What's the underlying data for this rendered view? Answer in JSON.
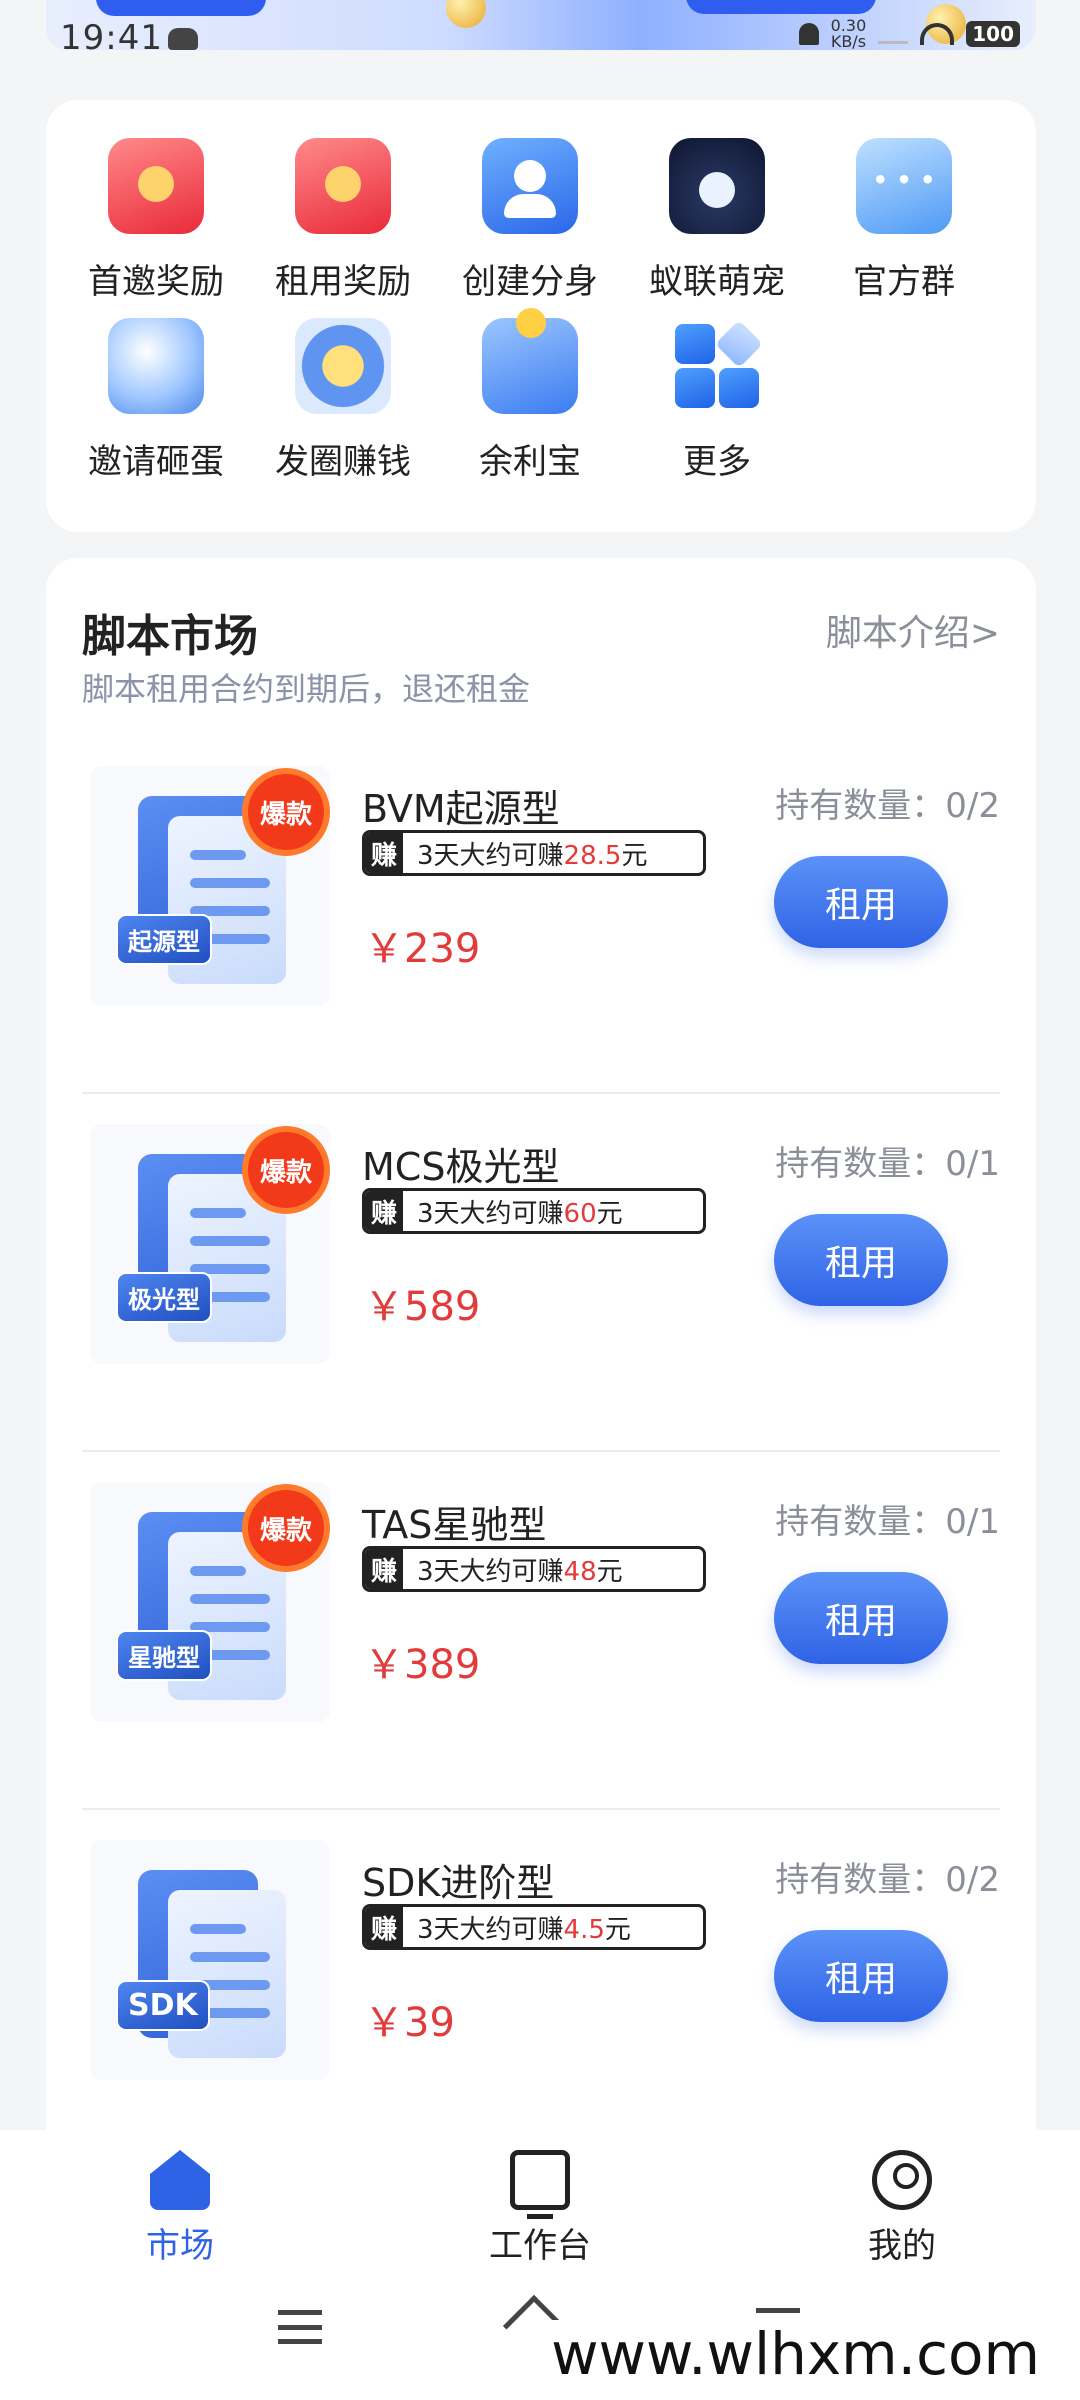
{
  "status_bar": {
    "time": "19:41",
    "net_speed_value": "0.30",
    "net_speed_unit": "KB/s",
    "battery": "100"
  },
  "shortcuts": [
    {
      "label": "首邀奖励",
      "icon": "red-envelope-icon"
    },
    {
      "label": "租用奖励",
      "icon": "red-envelope-icon"
    },
    {
      "label": "创建分身",
      "icon": "user-clone-icon"
    },
    {
      "label": "蚁联萌宠",
      "icon": "ant-pet-icon"
    },
    {
      "label": "官方群",
      "icon": "chat-group-icon"
    },
    {
      "label": "邀请砸蛋",
      "icon": "egg-icon"
    },
    {
      "label": "发圈赚钱",
      "icon": "coin-circle-icon"
    },
    {
      "label": "余利宝",
      "icon": "wallet-icon"
    },
    {
      "label": "更多",
      "icon": "more-grid-icon"
    }
  ],
  "market": {
    "title": "脚本市场",
    "subtitle": "脚本租用合约到期后，退还租金",
    "intro_link": "脚本介绍>",
    "products": [
      {
        "name": "BVM起源型",
        "tag": "起源型",
        "hot": "爆款",
        "earn_badge": "赚",
        "earn_prefix": "3天大约可赚",
        "earn_amount": "28.5",
        "earn_unit": "元",
        "price": "￥239",
        "holding": "持有数量：0/2",
        "button": "租用"
      },
      {
        "name": "MCS极光型",
        "tag": "极光型",
        "hot": "爆款",
        "earn_badge": "赚",
        "earn_prefix": "3天大约可赚",
        "earn_amount": "60",
        "earn_unit": "元",
        "price": "￥589",
        "holding": "持有数量：0/1",
        "button": "租用"
      },
      {
        "name": "TAS星驰型",
        "tag": "星驰型",
        "hot": "爆款",
        "earn_badge": "赚",
        "earn_prefix": "3天大约可赚",
        "earn_amount": "48",
        "earn_unit": "元",
        "price": "￥389",
        "holding": "持有数量：0/1",
        "button": "租用"
      },
      {
        "name": "SDK进阶型",
        "tag": "SDK",
        "hot": "",
        "earn_badge": "赚",
        "earn_prefix": "3天大约可赚",
        "earn_amount": "4.5",
        "earn_unit": "元",
        "price": "￥39",
        "holding": "持有数量：0/2",
        "button": "租用"
      }
    ]
  },
  "bottom_nav": [
    {
      "label": "市场",
      "icon": "home-icon",
      "active": true
    },
    {
      "label": "工作台",
      "icon": "workbench-icon",
      "active": false
    },
    {
      "label": "我的",
      "icon": "profile-icon",
      "active": false
    }
  ],
  "watermark": "www.wlhxm.com",
  "colors": {
    "accent": "#2f63e6",
    "price_red": "#e23b3b",
    "muted": "#8a8f99"
  }
}
